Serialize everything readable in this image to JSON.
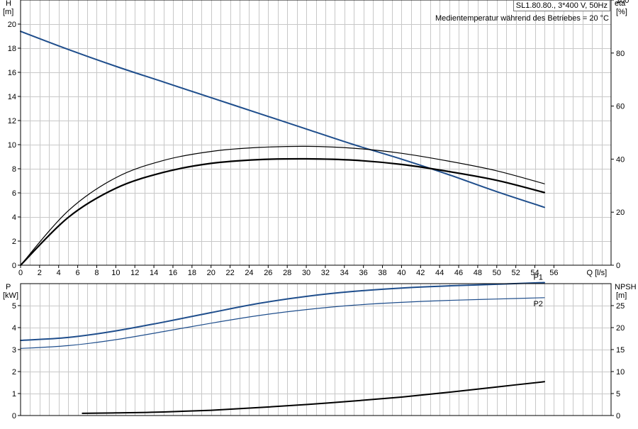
{
  "chart_data": [
    {
      "type": "line",
      "title": "SL1.80.80., 3*400 V, 50Hz",
      "subtitle": "Medientemperatur während des Betriebes = 20 °C",
      "xlabel": "Q [l/s]",
      "xlim": [
        0,
        62
      ],
      "xticks": [
        0,
        2,
        4,
        6,
        8,
        10,
        12,
        14,
        16,
        18,
        20,
        22,
        24,
        26,
        28,
        30,
        32,
        34,
        36,
        38,
        40,
        42,
        44,
        46,
        48,
        50,
        52,
        54,
        56
      ],
      "y_left": {
        "label": "H",
        "unit": "[m]",
        "lim": [
          0,
          22
        ],
        "ticks": [
          0,
          2,
          4,
          6,
          8,
          10,
          12,
          14,
          16,
          18,
          20
        ]
      },
      "y_right": {
        "label": "eta",
        "unit": "[%]",
        "lim": [
          0,
          100
        ],
        "ticks": [
          0,
          20,
          40,
          60,
          80,
          100
        ]
      },
      "grid": true,
      "series": [
        {
          "axis": "left",
          "color": "#1f4e8c",
          "width": 2,
          "x": [
            0,
            5,
            10,
            15,
            20,
            25,
            30,
            35,
            40,
            45,
            50,
            55
          ],
          "y": [
            19.4,
            17.9,
            16.5,
            15.2,
            13.9,
            12.6,
            11.3,
            10.0,
            8.8,
            7.5,
            6.1,
            4.8
          ]
        },
        {
          "axis": "right",
          "color": "#000000",
          "width": 1.2,
          "x": [
            0,
            5,
            10,
            15,
            20,
            25,
            30,
            35,
            40,
            45,
            50,
            55
          ],
          "y": [
            0,
            20.5,
            33.0,
            39.5,
            42.9,
            44.4,
            44.8,
            44.1,
            42.2,
            39.2,
            35.6,
            30.7
          ]
        },
        {
          "axis": "right",
          "color": "#000000",
          "width": 2.2,
          "x": [
            0,
            5,
            10,
            15,
            20,
            25,
            30,
            35,
            40,
            45,
            50,
            55
          ],
          "y": [
            0,
            18.0,
            29.0,
            35.0,
            38.4,
            39.8,
            40.1,
            39.6,
            38.0,
            35.3,
            32.0,
            27.4
          ]
        }
      ]
    },
    {
      "type": "line",
      "xlim": [
        0,
        62
      ],
      "y_left": {
        "label": "P",
        "unit": "[kW]",
        "lim": [
          0,
          6
        ],
        "ticks": [
          0,
          1,
          2,
          3,
          4,
          5
        ]
      },
      "y_right": {
        "label": "NPSH",
        "unit": "[m]",
        "lim": [
          0,
          30
        ],
        "ticks": [
          0,
          5,
          10,
          15,
          20,
          25
        ]
      },
      "grid": true,
      "series": [
        {
          "name": "P1",
          "axis": "left",
          "color": "#1f4e8c",
          "width": 2,
          "x": [
            0,
            5,
            10,
            15,
            20,
            25,
            30,
            35,
            40,
            45,
            50,
            55
          ],
          "y": [
            3.42,
            3.55,
            3.85,
            4.25,
            4.68,
            5.1,
            5.42,
            5.65,
            5.8,
            5.9,
            5.97,
            6.05
          ]
        },
        {
          "name": "P2",
          "axis": "left",
          "color": "#1f4e8c",
          "width": 1.2,
          "x": [
            0,
            5,
            10,
            15,
            20,
            25,
            30,
            35,
            40,
            45,
            50,
            55
          ],
          "y": [
            3.05,
            3.18,
            3.45,
            3.82,
            4.2,
            4.55,
            4.82,
            5.02,
            5.15,
            5.24,
            5.3,
            5.36
          ]
        },
        {
          "axis": "right",
          "color": "#000000",
          "width": 2,
          "x": [
            6.5,
            10,
            15,
            20,
            25,
            30,
            35,
            40,
            45,
            50,
            55
          ],
          "y": [
            0.5,
            0.6,
            0.8,
            1.2,
            1.8,
            2.5,
            3.3,
            4.2,
            5.3,
            6.5,
            7.7
          ]
        }
      ]
    }
  ]
}
